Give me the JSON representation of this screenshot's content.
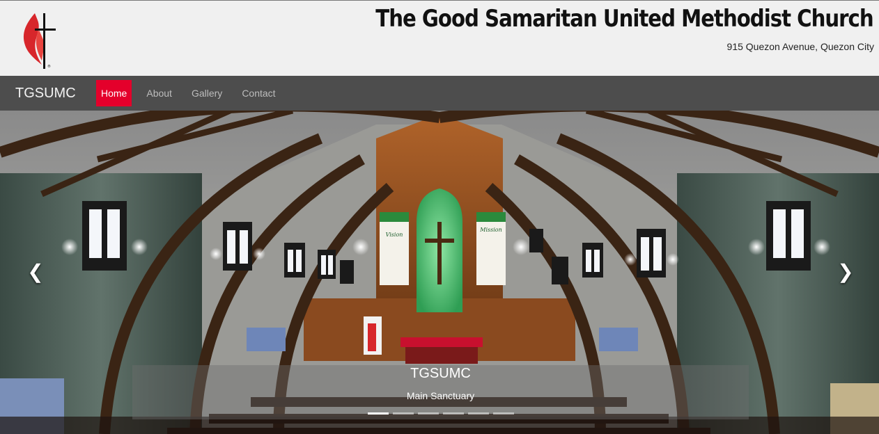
{
  "header": {
    "title": "The Good Samaritan United Methodist Church",
    "address": "915 Quezon Avenue, Quezon City",
    "logo_icon": "cross-and-flame-icon"
  },
  "nav": {
    "brand": "TGSUMC",
    "items": [
      {
        "label": "Home",
        "active": true
      },
      {
        "label": "About",
        "active": false
      },
      {
        "label": "Gallery",
        "active": false
      },
      {
        "label": "Contact",
        "active": false
      }
    ]
  },
  "carousel": {
    "slide_title": "TGSUMC",
    "slide_caption": "Main Sanctuary",
    "prev_icon": "chevron-left-icon",
    "next_icon": "chevron-right-icon",
    "slide_count": 6,
    "active_slide": 1,
    "banners": {
      "left": "Vision",
      "right": "Mission"
    }
  },
  "colors": {
    "accent": "#e4002b",
    "nav_bg": "#4d4d4d",
    "header_bg": "#f0f0f0"
  }
}
